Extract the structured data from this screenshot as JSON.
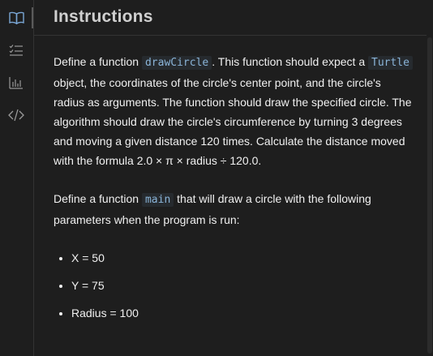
{
  "sidebar": {
    "items": [
      {
        "icon": "book-open-icon",
        "label": ""
      },
      {
        "icon": "checklist-icon",
        "label": ""
      },
      {
        "icon": "bar-chart-icon",
        "label": ""
      },
      {
        "icon": "code-icon",
        "label": ""
      }
    ]
  },
  "header": {
    "title": "Instructions"
  },
  "instructions": {
    "p1": {
      "t1": "Define a function ",
      "code1": "drawCircle",
      "t2": ". This function should expect a ",
      "code2": "Turtle",
      "t3": " object, the coordinates of the circle's center point, and the circle's radius as arguments. The function should draw the specified circle. The algorithm should draw the circle's circumference by turning 3 degrees and moving a given distance 120 times. Calculate the distance moved with the formula 2.0 × π × radius ÷ 120.0."
    },
    "p2": {
      "t1": "Define a function ",
      "code1": "main",
      "t2": " that will draw a circle with the following parameters when the program is run:"
    },
    "bullets": [
      "X = 50",
      "Y = 75",
      "Radius = 100"
    ]
  }
}
